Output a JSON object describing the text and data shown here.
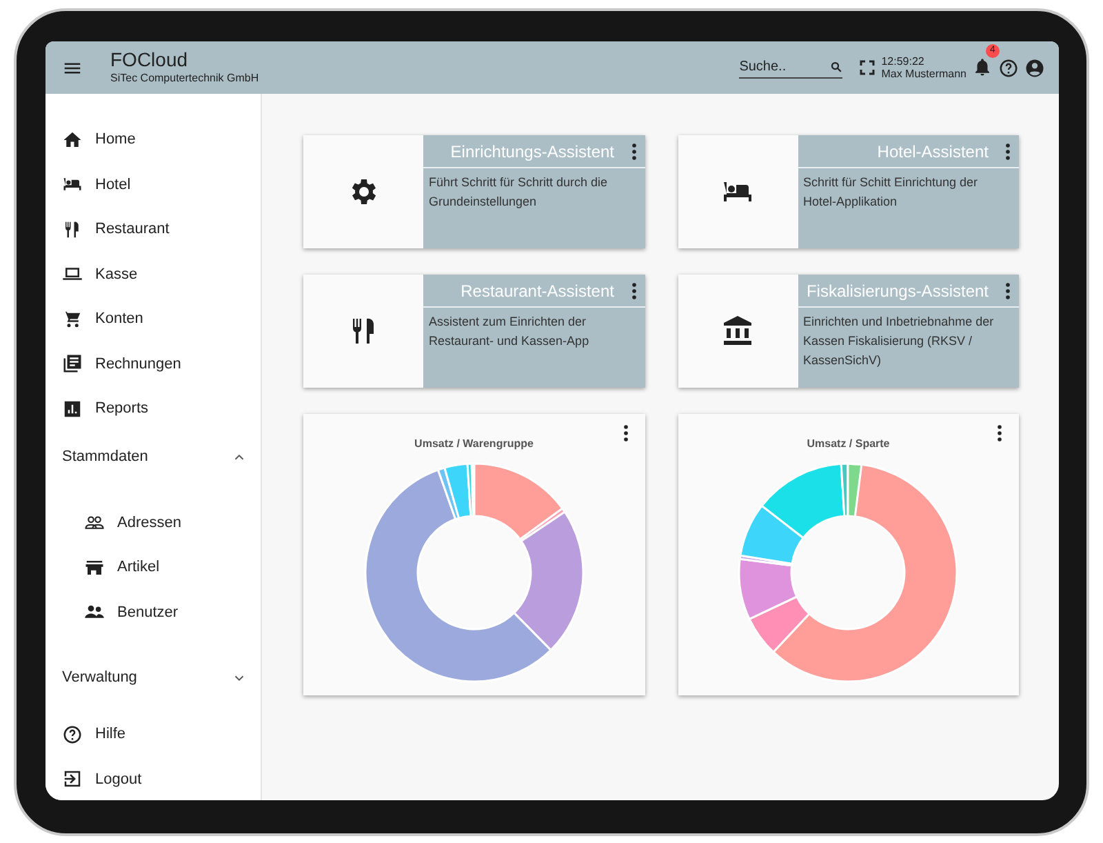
{
  "app": {
    "title": "FOCloud",
    "subtitle": "SiTec Computertechnik GmbH"
  },
  "header": {
    "search": {
      "placeholder": "Suche.."
    },
    "clock": "12:59:22",
    "user": "Max Mustermann",
    "notifications": "4"
  },
  "sidebar": {
    "items": [
      {
        "kind": "link",
        "label": "Home"
      },
      {
        "kind": "link",
        "label": "Hotel"
      },
      {
        "kind": "link",
        "label": "Restaurant"
      },
      {
        "kind": "link",
        "label": "Kasse"
      },
      {
        "kind": "link",
        "label": "Konten"
      },
      {
        "kind": "link",
        "label": "Rechnungen"
      },
      {
        "kind": "link",
        "label": "Reports"
      },
      {
        "kind": "group",
        "label": "Stammdaten",
        "expanded": true,
        "children": [
          {
            "label": "Adressen"
          },
          {
            "label": "Artikel"
          },
          {
            "label": "Benutzer"
          }
        ]
      },
      {
        "kind": "group",
        "label": "Verwaltung",
        "expanded": false
      },
      {
        "kind": "link",
        "label": "Hilfe"
      },
      {
        "kind": "link",
        "label": "Logout"
      }
    ]
  },
  "assistants": [
    {
      "title": "Einrichtungs-Assistent",
      "description": "Führt Schritt für Schritt durch die Grundeinstellungen"
    },
    {
      "title": "Hotel-Assistent",
      "description": "Schritt für Schitt Einrichtung der Hotel-Applikation"
    },
    {
      "title": "Restaurant-Assistent",
      "description": "Assistent zum Einrichten der Restaurant- und Kassen-App"
    },
    {
      "title": "Fiskalisierungs-Assistent",
      "description": "Einrichten und Inbetriebnahme der Kassen Fiskalisierung (RKSV / KassenSichV)"
    }
  ],
  "charts": [
    {
      "title": "Umsatz / Warengruppe"
    },
    {
      "title": "Umsatz / Sparte"
    }
  ]
}
